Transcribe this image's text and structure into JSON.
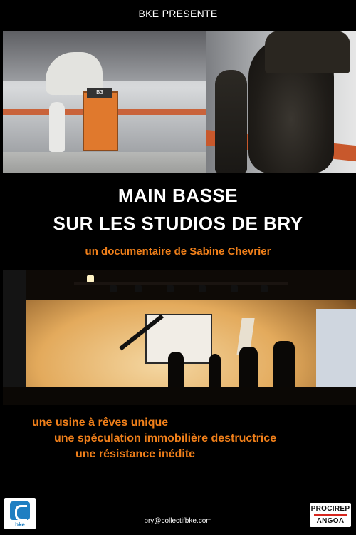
{
  "header": {
    "presente": "BKE PRESENTE"
  },
  "title": {
    "line1": "MAIN BASSE",
    "line2": "SUR LES STUDIOS DE BRY"
  },
  "subtitle": "un documentaire de Sabine Chevrier",
  "photo_top": {
    "door_sign": "B3"
  },
  "taglines": [
    "une usine à rêves unique",
    "une spéculation immobilière destructrice",
    "une résistance inédite"
  ],
  "footer": {
    "email": "bry@collectifbke.com",
    "logo_left_label": "bke",
    "logo_right_line1": "PROCIREP",
    "logo_right_line2": "ANGOA"
  },
  "colors": {
    "accent": "#ef7f1a",
    "background": "#000000"
  }
}
